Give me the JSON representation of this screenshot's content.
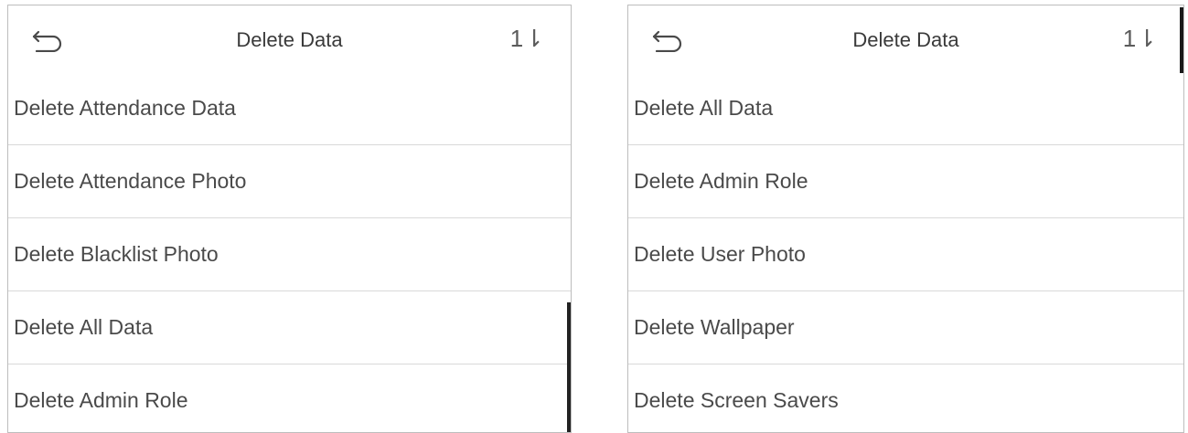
{
  "left_screen": {
    "title": "Delete Data",
    "sort_glyph": "1⇂",
    "items": [
      {
        "label": "Delete Attendance Data"
      },
      {
        "label": "Delete Attendance Photo"
      },
      {
        "label": "Delete Blacklist Photo"
      },
      {
        "label": "Delete All Data"
      },
      {
        "label": "Delete Admin Role"
      }
    ]
  },
  "right_screen": {
    "title": "Delete Data",
    "sort_glyph": "1⇂",
    "items": [
      {
        "label": "Delete All Data"
      },
      {
        "label": "Delete Admin Role"
      },
      {
        "label": "Delete User Photo"
      },
      {
        "label": "Delete Wallpaper"
      },
      {
        "label": "Delete Screen Savers"
      }
    ]
  },
  "icons": {
    "back": "back-arrow-icon",
    "sort": "sort-icon"
  }
}
